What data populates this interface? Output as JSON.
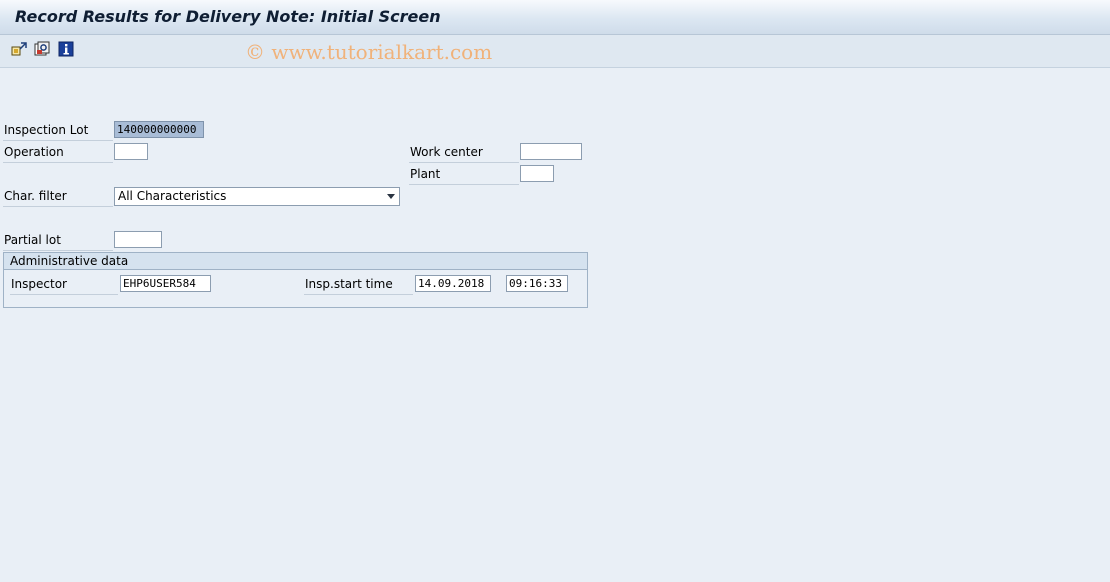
{
  "window": {
    "title": "Record Results for Delivery Note: Initial Screen"
  },
  "watermark": "© www.tutorialkart.com",
  "toolbar": {
    "icons": [
      "change-layout-icon",
      "settings-icon",
      "info-icon"
    ]
  },
  "form": {
    "inspection_lot": {
      "label": "Inspection Lot",
      "value": "140000000000"
    },
    "operation": {
      "label": "Operation",
      "value": ""
    },
    "work_center": {
      "label": "Work center",
      "value": ""
    },
    "plant": {
      "label": "Plant",
      "value": ""
    },
    "char_filter": {
      "label": "Char. filter",
      "value": "All Characteristics"
    },
    "partial_lot": {
      "label": "Partial lot",
      "value": ""
    }
  },
  "admin": {
    "title": "Administrative data",
    "inspector": {
      "label": "Inspector",
      "value": "EHP6USER584"
    },
    "insp_start_time": {
      "label": "Insp.start time",
      "date": "14.09.2018",
      "time": "09:16:33"
    }
  }
}
